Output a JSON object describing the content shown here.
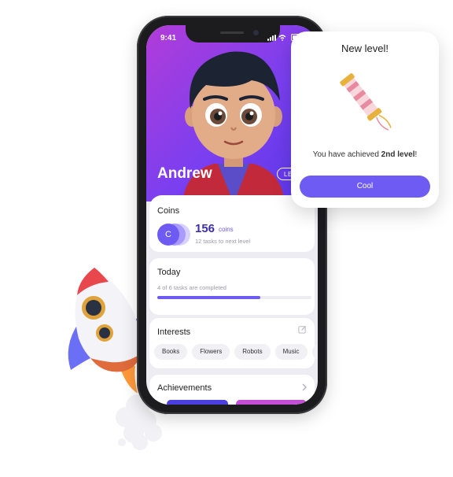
{
  "status_bar": {
    "time": "9:41"
  },
  "profile": {
    "name": "Andrew",
    "level_badge": "LEV"
  },
  "coins": {
    "title": "Coins",
    "coin_letter": "C",
    "amount": "156",
    "unit": "coins",
    "subtitle": "12 tasks to next level"
  },
  "today": {
    "title": "Today",
    "subtitle": "4 of 6 tasks are completed",
    "progress": 0.67
  },
  "interests": {
    "title": "Interests",
    "chips": [
      "Books",
      "Flowers",
      "Robots",
      "Music",
      "S"
    ]
  },
  "achievements": {
    "title": "Achievements"
  },
  "popup": {
    "title": "New level!",
    "message_prefix": "You have achieved ",
    "message_bold": "2nd level",
    "message_suffix": "!",
    "button_label": "Cool"
  },
  "colors": {
    "accent": "#6d5bf3",
    "hero_gradient_start": "#b23cd9",
    "hero_gradient_end": "#5a37e8"
  },
  "icons": [
    "signal-icon",
    "wifi-icon",
    "battery-icon",
    "edit-icon",
    "chevron-right-icon",
    "firework-icon",
    "rocket-illustration"
  ]
}
